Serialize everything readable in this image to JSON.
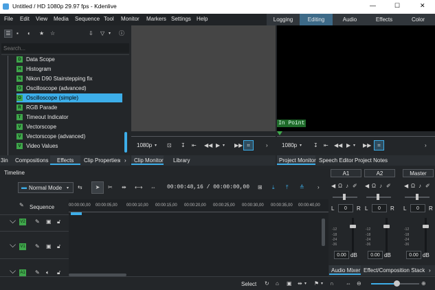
{
  "window": {
    "title": "Untitled / HD 1080p 29.97 fps - Kdenlive",
    "minimize": "—",
    "maximize": "☐",
    "close": "✕"
  },
  "menu": [
    "File",
    "Edit",
    "View",
    "Media",
    "Sequence",
    "Tool",
    "Monitor",
    "Markers",
    "Settings",
    "Help"
  ],
  "workspaces": [
    "Logging",
    "Editing",
    "Audio",
    "Effects",
    "Color"
  ],
  "search": {
    "placeholder": "Search..."
  },
  "effects": [
    {
      "badge": "D",
      "label": "Data Scope"
    },
    {
      "badge": "H",
      "label": "Histogram"
    },
    {
      "badge": "N",
      "label": "Nikon D90 Stairstepping fix"
    },
    {
      "badge": "O",
      "label": "Oscilloscope (advanced)"
    },
    {
      "badge": "O",
      "label": "Oscilloscope (simple)"
    },
    {
      "badge": "R",
      "label": "RGB Parade"
    },
    {
      "badge": "T",
      "label": "Timeout Indicator"
    },
    {
      "badge": "V",
      "label": "Vectorscope"
    },
    {
      "badge": "V",
      "label": "Vectorscope (advanced)"
    },
    {
      "badge": "V",
      "label": "Video Values"
    }
  ],
  "left_tabs": [
    "3in",
    "Compositions",
    "Effects",
    "Clip Properties"
  ],
  "clip_monitor": {
    "resolution": "1080p",
    "tabs": [
      "Clip Monitor",
      "Library"
    ]
  },
  "project_monitor": {
    "resolution": "1080p",
    "in_point": "In Point",
    "tabs": [
      "Project Monitor",
      "Speech Editor",
      "Project Notes"
    ]
  },
  "timeline": {
    "title": "Timeline",
    "mode": "Normal Mode",
    "timecode": "00:00:48,16 / 00:00:00,00",
    "sequence_label": "Sequence",
    "ruler": [
      "00:00:00,00",
      "00:00:05,00",
      "00:00:10,00",
      "00:00:15,00",
      "00:00:20,00",
      "00:00:25,00",
      "00:00:30,00",
      "00:00:35,00",
      "00:00:40,00"
    ],
    "tracks": [
      "V2",
      "V1",
      "A1"
    ]
  },
  "mixer": {
    "channels": [
      {
        "name": "A1",
        "value": "0",
        "db": "0.00",
        "unit": "dB"
      },
      {
        "name": "A2",
        "value": "0",
        "db": "0.00",
        "unit": "dB"
      },
      {
        "name": "Master",
        "value": "0",
        "db": "0.00",
        "unit": "dB"
      }
    ],
    "left": "L",
    "right": "R",
    "scale": [
      "-12",
      "-18",
      "-24",
      "-36"
    ],
    "tabs": [
      "Audio Mixer",
      "Effect/Composition Stack"
    ]
  },
  "status": {
    "select": "Select"
  },
  "colors": {
    "accent": "#3daee9",
    "badge": "#3fa64b",
    "selection": "#3daee9"
  }
}
